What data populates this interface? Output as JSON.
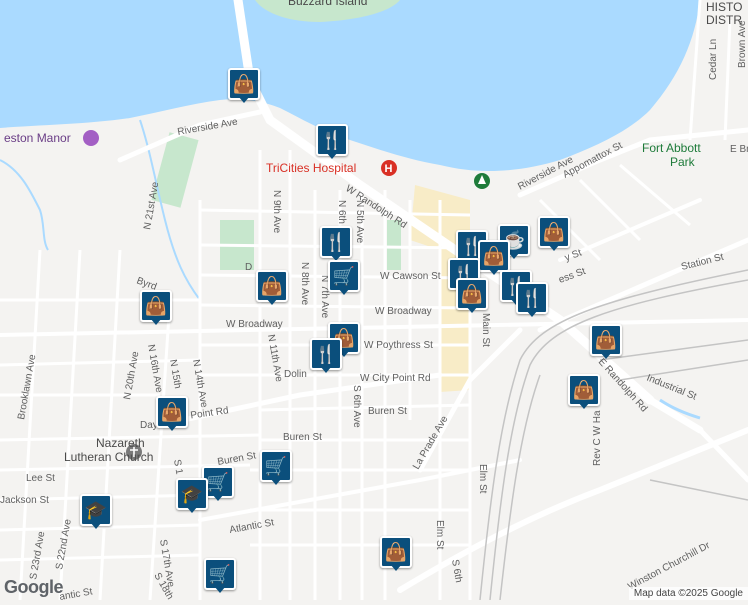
{
  "map": {
    "water_label": "Buzzard Island",
    "hospital_label": "TriCities Hospital",
    "park_label_line1": "Fort Abbott",
    "park_label_line2": "Park",
    "manor_label": "eston Manor",
    "church_label_line1": "Nazareth",
    "church_label_line2": "Lutheran Church",
    "historic_line1": "HISTO",
    "historic_line2": "DISTR",
    "street_labels": {
      "w_randolph_rd": "W Randolph Rd",
      "riverside_ave_w": "Riverside Ave",
      "riverside_ave_e": "Riverside Ave",
      "appomattox_st": "Appomattox St",
      "w_cawson_st": "W Cawson St",
      "w_broadway_e": "W Broadway",
      "w_broadway_w": "W Broadway",
      "w_poythress_st": "W Poythress St",
      "w_city_point_rd_e": "W City Point Rd",
      "w_city_point_rd_w": "W City Point Rd",
      "dolin": "Dolin",
      "buren_st_e": "Buren St",
      "buren_st_w": "Buren St",
      "buren_st_sw": "Buren St",
      "la_prade_ave": "La Prade Ave",
      "elm_st_n": "Elm St",
      "elm_st_s": "Elm St",
      "main_st": "Main St",
      "e_randolph_rd": "E Randolph Rd",
      "industrial_st": "Industrial St",
      "rev_cw_harris": "Rev C W Ha",
      "winston_churchill_dr": "Winston Churchill Dr",
      "station_st": "Station St",
      "e_broadway": "E Br",
      "cedar_ln": "Cedar Ln",
      "brown_ave": "Brown Ave",
      "n_21st_ave": "N 21st Ave",
      "n_20th_ave": "N 20th Ave",
      "n_16th_ave": "N 16th Ave",
      "n_15th": "N 15th",
      "n_14th_ave": "N 14th Ave",
      "n_11th_ave": "N 11th Ave",
      "n_9th_ave": "N 9th Ave",
      "n_8th_ave": "N 8th Ave",
      "n_7th_ave": "N 7th Ave",
      "n_6th_ave": "N 6th",
      "n_5th_ave": "N 5th Ave",
      "s_6th_ave": "S 6th Ave",
      "s_6th_lower": "S 6th",
      "brooklawn_ave": "Brooklawn Ave",
      "byrd": "Byrd",
      "lee_st": "Lee St",
      "jackson_st": "Jackson St",
      "atlantic_st_e": "Atlantic St",
      "atlantic_st_w": "antic St",
      "s_22nd_ave": "S 22nd Ave",
      "s_23rd_ave": "S 23rd Ave",
      "s_17th_ave": "S 17th Ave",
      "s_18th": "S 18th",
      "s_1": "S 1",
      "d_left": "D",
      "day": "Day",
      "w_main_part": "W",
      "ess_st": "ess St",
      "stay_st": "y St"
    },
    "attribution": "Map data ©2025 Google",
    "google_logo": "Google"
  },
  "pois": [
    {
      "name": "shopping-bag-marker-north",
      "icon": "shopping-bag-icon",
      "glyph": "👜"
    },
    {
      "name": "restaurant-marker-hospital",
      "icon": "fork-knife-icon",
      "glyph": "🍴"
    },
    {
      "name": "restaurant-marker-5th",
      "icon": "fork-knife-icon",
      "glyph": "🍴"
    },
    {
      "name": "shopping-bag-marker-8th",
      "icon": "shopping-bag-icon",
      "glyph": "👜"
    },
    {
      "name": "cart-marker-7th",
      "icon": "shopping-cart-icon",
      "glyph": "🛒"
    },
    {
      "name": "shopping-bag-marker-byrd",
      "icon": "shopping-bag-icon",
      "glyph": "👜"
    },
    {
      "name": "shopping-bag-marker-poythress",
      "icon": "shopping-bag-icon",
      "glyph": "👜"
    },
    {
      "name": "restaurant-marker-poythress",
      "icon": "fork-knife-icon",
      "glyph": "🍴"
    },
    {
      "name": "shopping-bag-marker-citypoint",
      "icon": "shopping-bag-icon",
      "glyph": "👜"
    },
    {
      "name": "cart-marker-buren",
      "icon": "shopping-cart-icon",
      "glyph": "🛒"
    },
    {
      "name": "cart-marker-atlantic",
      "icon": "shopping-cart-icon",
      "glyph": "🛒"
    },
    {
      "name": "school-marker-atlantic",
      "icon": "graduation-cap-icon",
      "glyph": "🎓"
    },
    {
      "name": "school-marker-22nd",
      "icon": "graduation-cap-icon",
      "glyph": "🎓"
    },
    {
      "name": "cart-marker-south",
      "icon": "shopping-cart-icon",
      "glyph": "🛒"
    },
    {
      "name": "shopping-bag-marker-elm",
      "icon": "shopping-bag-icon",
      "glyph": "👜"
    },
    {
      "name": "restaurant-marker-downtown-1",
      "icon": "fork-knife-icon",
      "glyph": "🍴"
    },
    {
      "name": "coffee-marker-downtown",
      "icon": "coffee-cup-icon",
      "glyph": "☕"
    },
    {
      "name": "shopping-bag-marker-downtown-1",
      "icon": "shopping-bag-icon",
      "glyph": "👜"
    },
    {
      "name": "shopping-bag-marker-downtown-2",
      "icon": "shopping-bag-icon",
      "glyph": "👜"
    },
    {
      "name": "restaurant-marker-downtown-2",
      "icon": "fork-knife-icon",
      "glyph": "🍴"
    },
    {
      "name": "shopping-bag-marker-downtown-3",
      "icon": "shopping-bag-icon",
      "glyph": "👜"
    },
    {
      "name": "restaurant-marker-downtown-3",
      "icon": "fork-knife-icon",
      "glyph": "🍴"
    },
    {
      "name": "restaurant-marker-downtown-4",
      "icon": "fork-knife-icon",
      "glyph": "🍴"
    },
    {
      "name": "shopping-bag-marker-randolph",
      "icon": "shopping-bag-icon",
      "glyph": "👜"
    },
    {
      "name": "shopping-bag-marker-industrial",
      "icon": "shopping-bag-icon",
      "glyph": "👜"
    }
  ],
  "colors": {
    "water": "#aadaff",
    "land": "#f4f3f1",
    "road": "#ffffff",
    "park": "#c7e7cd",
    "downtown": "#f8ecc7",
    "rail": "#c4c4c4",
    "marker": "#0b4f7c"
  }
}
